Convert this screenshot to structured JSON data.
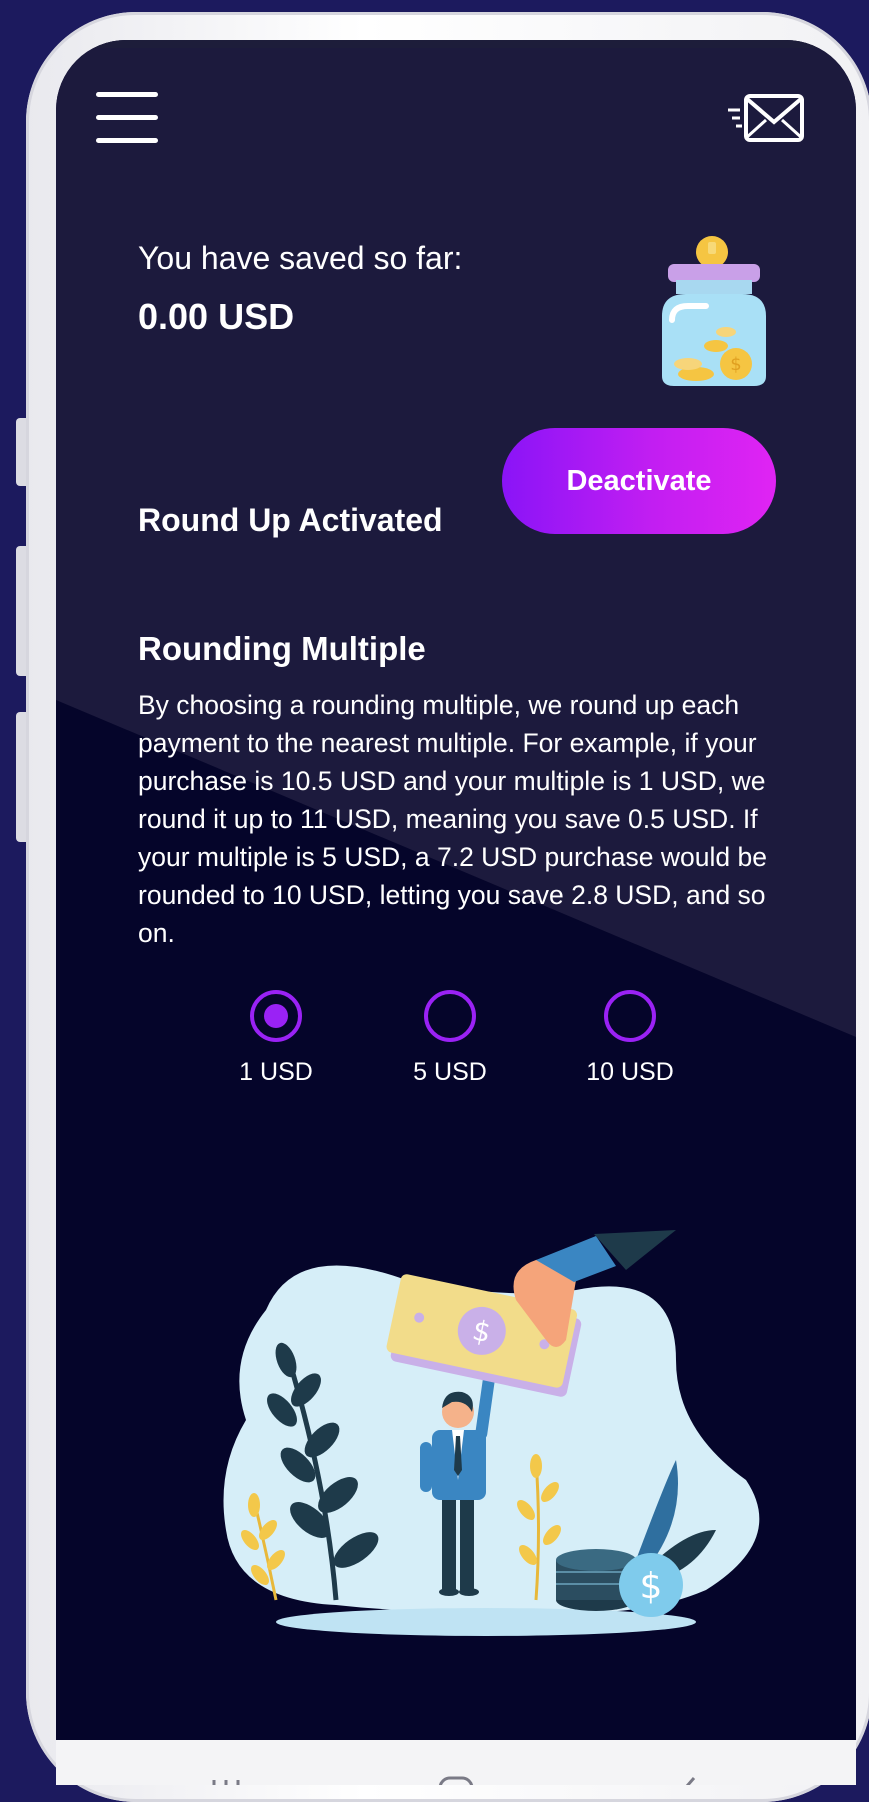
{
  "header": {
    "menu_icon": "hamburger-menu-icon",
    "inbox_icon": "mail-envelope-icon"
  },
  "savings": {
    "label": "You have saved so far:",
    "amount": "0.00 USD",
    "image_icon": "savings-jar-icon"
  },
  "round_up": {
    "status_label": "Round Up Activated",
    "button_label": "Deactivate"
  },
  "rounding": {
    "title": "Rounding Multiple",
    "description": "By choosing a rounding multiple, we round up each payment to the nearest multiple. For example, if your purchase is 10.5 USD and your multiple is 1 USD, we round it up to 11 USD, meaning you save 0.5 USD. If your multiple is 5 USD, a 7.2 USD purchase would be rounded to 10 USD, letting you save 2.8 USD, and so on.",
    "options": [
      {
        "label": "1 USD",
        "selected": true
      },
      {
        "label": "5 USD",
        "selected": false
      },
      {
        "label": "10 USD",
        "selected": false
      }
    ]
  },
  "navbar": {
    "recent_icon": "recent-apps-icon",
    "home_icon": "home-icon",
    "back_icon": "back-icon"
  },
  "colors": {
    "background": "#05052a",
    "accent": "#9a22f5",
    "button_gradient_start": "#8a14f7",
    "button_gradient_end": "#e024f3"
  }
}
